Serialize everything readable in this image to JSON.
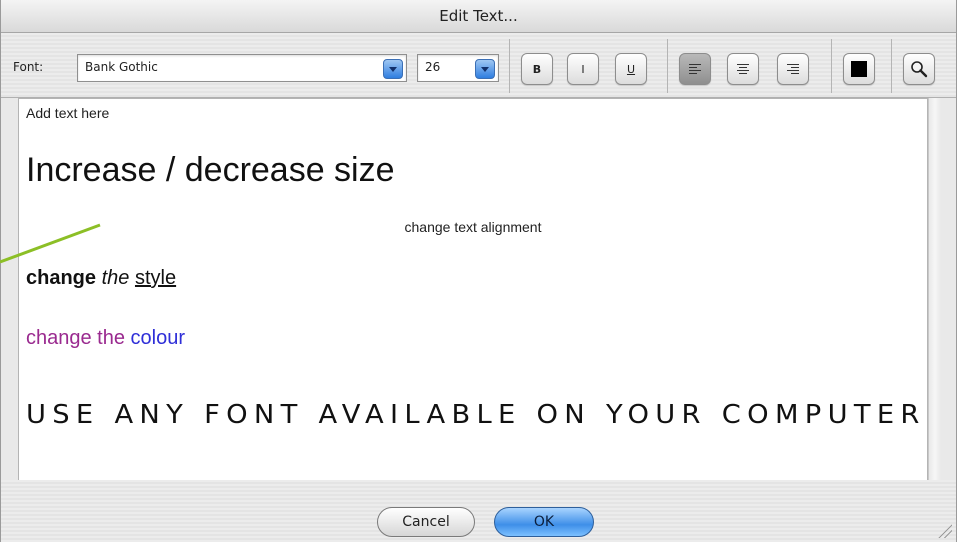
{
  "window": {
    "title": "Edit Text..."
  },
  "toolbar": {
    "font_label": "Font:",
    "font_value": "Bank Gothic",
    "size_value": "26",
    "bold_label": "B",
    "italic_label": "I",
    "underline_label": "U"
  },
  "content": {
    "line1": "Add text here",
    "line2": "Increase / decrease size",
    "line3": "change text alignment",
    "line4": {
      "bold": "change",
      "italic": "the",
      "underline": "style"
    },
    "line5": {
      "part1": "change the ",
      "part2": "colour"
    },
    "line6": "USE ANY FONT AVAILABLE ON YOUR COMPUTER"
  },
  "footer": {
    "cancel_label": "Cancel",
    "ok_label": "OK"
  },
  "colors": {
    "ok_button": "#3e8fe8",
    "purple_text": "#9a2a8f",
    "blue_text": "#2f2fd8",
    "annotation_line": "#8cbf26"
  }
}
